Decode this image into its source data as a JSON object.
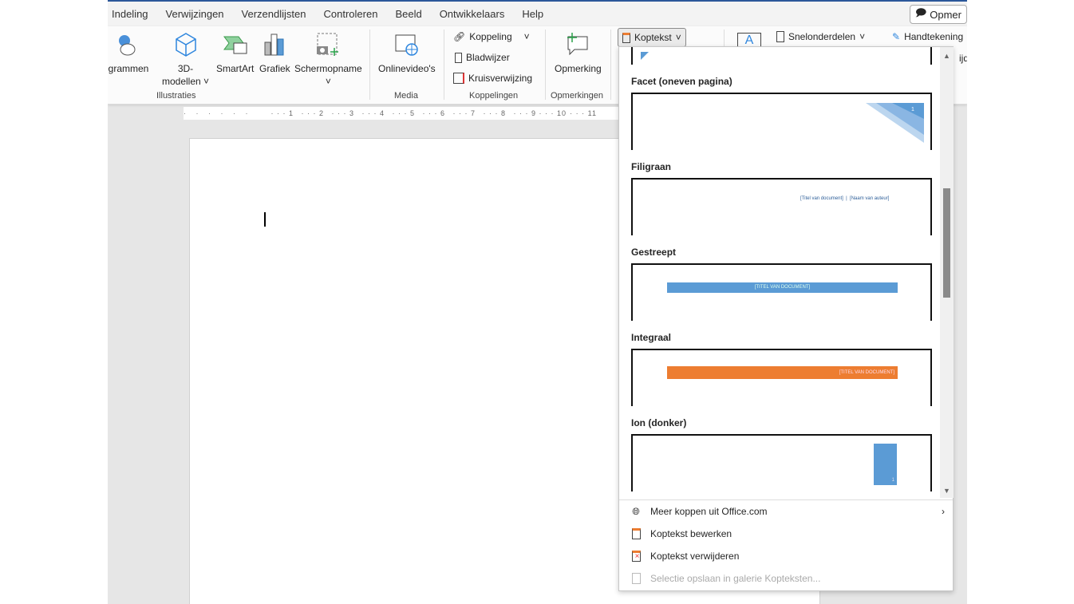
{
  "tabs": [
    "Indeling",
    "Verwijzingen",
    "Verzendlijsten",
    "Controleren",
    "Beeld",
    "Ontwikkelaars",
    "Help"
  ],
  "comment_button": "Opmer",
  "ribbon": {
    "icons_label": "ictogrammen",
    "models_label": "3D-",
    "models_label2": "modellen",
    "smartart": "SmartArt",
    "chart": "Grafiek",
    "screenshot": "Schermopname",
    "group_illustraties": "Illustraties",
    "online_video": "Onlinevideo's",
    "group_media": "Media",
    "link": "Koppeling",
    "bookmark": "Bladwijzer",
    "crossref": "Kruisverwijzing",
    "group_links": "Koppelingen",
    "comment": "Opmerking",
    "group_comments": "Opmerkingen",
    "header": "Koptekst",
    "quickparts": "Snelonderdelen",
    "signature": "Handtekening",
    "datetime_partial": "ijd"
  },
  "ruler_ticks": [
    "1",
    "2",
    "3",
    "4",
    "5",
    "6",
    "7",
    "8",
    "9",
    "10",
    "11"
  ],
  "gallery": [
    {
      "name": "Facet (oneven pagina)",
      "page_num": "1"
    },
    {
      "name": "Filigraan",
      "text": "[Titel van document]  |  [Naam van auteur]"
    },
    {
      "name": "Gestreept",
      "text": "[TITEL VAN DOCUMENT]"
    },
    {
      "name": "Integraal",
      "text": "[TITEL VAN DOCUMENT]"
    },
    {
      "name": "Ion (donker)",
      "page_num": "1"
    }
  ],
  "menu": [
    {
      "label": "Meer koppen uit Office.com",
      "icon": "globe-icon",
      "submenu": true
    },
    {
      "label": "Koptekst bewerken",
      "icon": "edit-header-icon"
    },
    {
      "label": "Koptekst verwijderen",
      "icon": "remove-header-icon"
    },
    {
      "label": "Selectie opslaan in galerie Kopteksten...",
      "icon": "save-gallery-icon",
      "disabled": true
    }
  ],
  "colors": {
    "blue": "#5b9bd5",
    "orange": "#ed7d31",
    "accent": "#2b579a"
  }
}
